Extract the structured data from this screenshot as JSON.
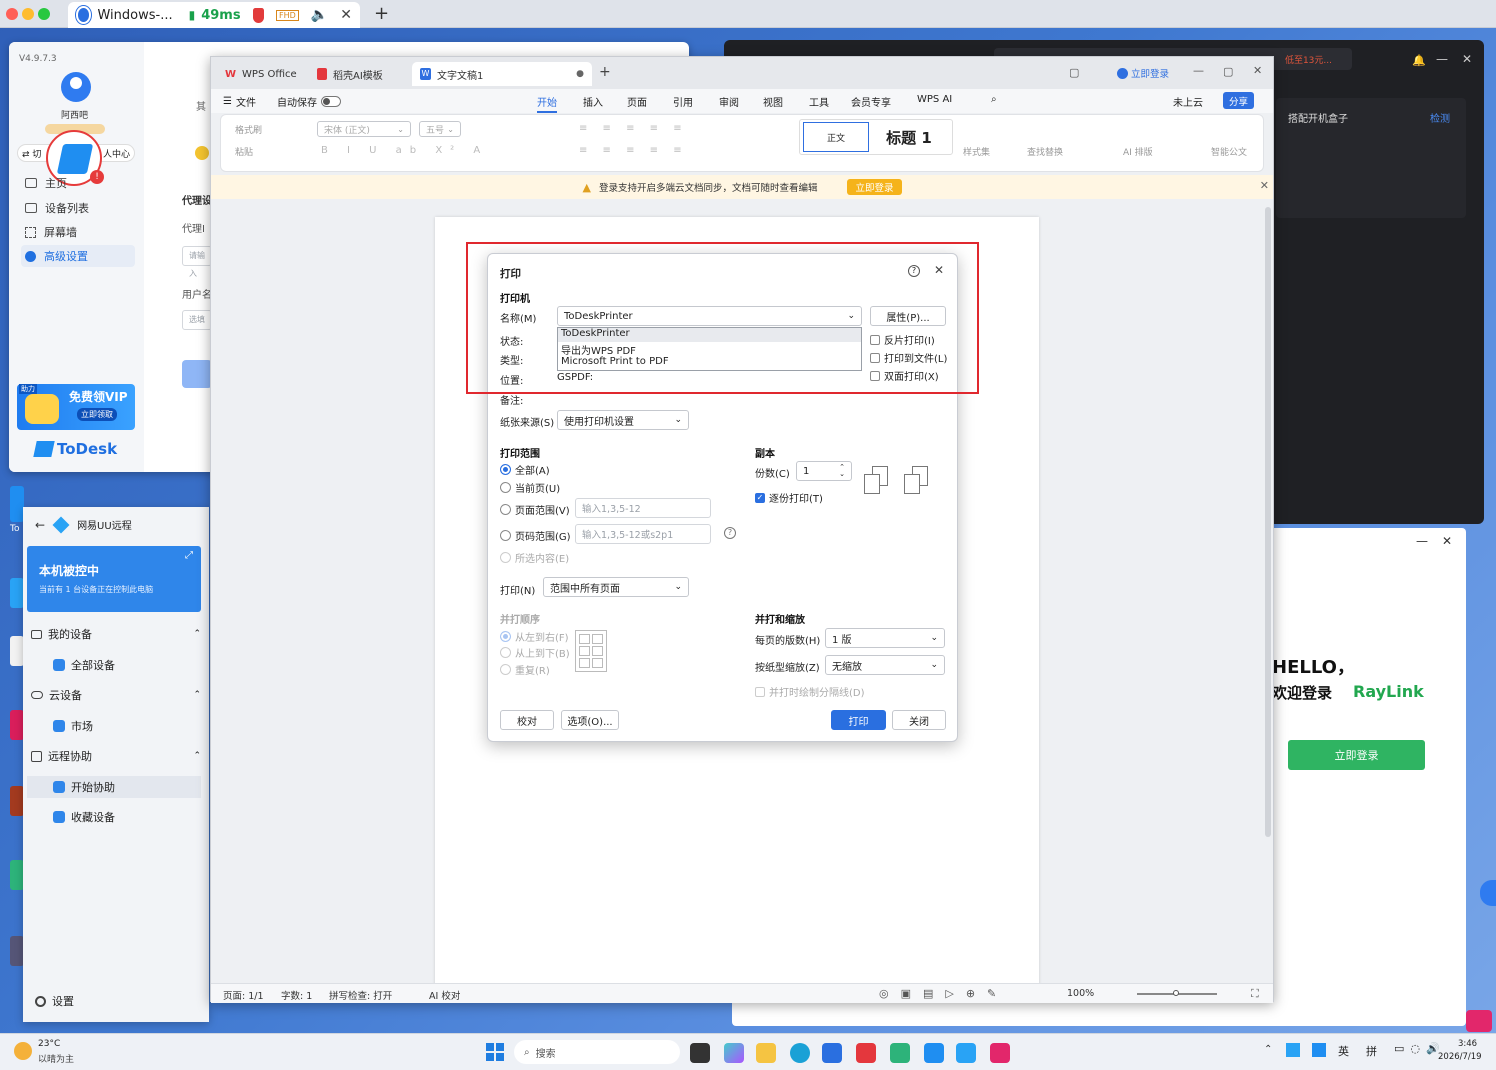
{
  "browser": {
    "tab_title": "Windows-...",
    "latency": "49ms",
    "fhd": "FHD",
    "new_tab": "+"
  },
  "todesk": {
    "version": "V4.9.7.3",
    "username": "阿西吧",
    "switch_label": "⇄ 切",
    "personal_center": "人中心",
    "nav": [
      "主页",
      "设备列表",
      "屏幕墙",
      "高级设置"
    ],
    "main_label_1": "其",
    "proxy_title": "代理设",
    "proxy_label": "代理I",
    "user_label": "用户名",
    "placeholder_1": "请输入",
    "placeholder_2": "选填",
    "vip_tag": "助力",
    "vip_text": "免费领VIP",
    "vip_btn": "立即领取",
    "brand": "ToDesk",
    "side_label": "To"
  },
  "uu": {
    "title": "网易UU远程",
    "status_title": "本机被控中",
    "status_sub": "当前有 1 台设备正在控制此电脑",
    "sections": [
      {
        "label": "我的设备",
        "children": [
          "全部设备"
        ]
      },
      {
        "label": "云设备",
        "children": [
          "市场"
        ]
      },
      {
        "label": "远程协助",
        "children": [
          "开始协助",
          "收藏设备"
        ]
      }
    ],
    "settings": "设置"
  },
  "dark_window": {
    "promo": "低至13元...",
    "item": "搭配开机盒子",
    "detect": "检测"
  },
  "raylink": {
    "hello": "HELLO，",
    "welcome": "欢迎登录",
    "brand": "RayLink",
    "login": "立即登录"
  },
  "wps": {
    "tabs": [
      "WPS Office",
      "稻壳AI模板",
      "文字文稿1"
    ],
    "login": "立即登录",
    "menu": [
      "文件",
      "自动保存",
      "开始",
      "插入",
      "页面",
      "引用",
      "审阅",
      "视图",
      "工具",
      "会员专享",
      "WPS AI"
    ],
    "cloud": "未上云",
    "share": "分享",
    "ribbon": {
      "format_painter": "格式刷",
      "paste": "粘贴",
      "font": "宋体 (正文)",
      "size": "五号",
      "style_normal": "正文",
      "style_h1": "标题 1",
      "style_set": "样式集",
      "find_replace": "查找替换",
      "ai_layout": "AI 排版",
      "smart_doc": "智能公文"
    },
    "notice": "登录支持开启多端云文档同步，文档可随时查看编辑",
    "notice_btn": "立即登录",
    "status": {
      "page": "页面: 1/1",
      "words": "字数: 1",
      "spell": "拼写检查: 打开",
      "ai_check": "AI 校对",
      "zoom": "100%"
    }
  },
  "print_dialog": {
    "title": "打印",
    "printer_section": "打印机",
    "name_label": "名称(M)",
    "name_value": "ToDeskPrinter",
    "properties": "属性(P)...",
    "printer_options": [
      "ToDeskPrinter",
      "导出为WPS PDF",
      "Microsoft Print to PDF"
    ],
    "status_label": "状态:",
    "type_label": "类型:",
    "location_label": "位置:",
    "location_value": "GSPDF:",
    "comment_label": "备注:",
    "reverse": "反片打印(I)",
    "to_file": "打印到文件(L)",
    "duplex": "双面打印(X)",
    "paper_source_label": "纸张来源(S)",
    "paper_source_value": "使用打印机设置",
    "range_section": "打印范围",
    "range_all": "全部(A)",
    "range_current": "当前页(U)",
    "range_pages": "页面范围(V)",
    "range_pages_ph": "输入1,3,5-12",
    "range_pagenum": "页码范围(G)",
    "range_pagenum_ph": "输入1,3,5-12或s2p1",
    "range_selection": "所选内容(E)",
    "copies_section": "副本",
    "copies_label": "份数(C)",
    "copies_value": "1",
    "collate": "逐份打印(T)",
    "print_label": "打印(N)",
    "print_value": "范围中所有页面",
    "order_section": "并打顺序",
    "order_ltr": "从左到右(F)",
    "order_ttb": "从上到下(B)",
    "order_repeat": "重复(R)",
    "zoom_section": "并打和缩放",
    "pages_per_sheet_label": "每页的版数(H)",
    "pages_per_sheet_value": "1 版",
    "scale_label": "按纸型缩放(Z)",
    "scale_value": "无缩放",
    "draw_lines": "并打时绘制分隔线(D)",
    "proof": "校对",
    "options": "选项(O)...",
    "print": "打印",
    "close": "关闭"
  },
  "taskbar": {
    "temp": "23°C",
    "weather": "以晴为主",
    "search": "搜索",
    "ime_1": "英",
    "ime_2": "拼",
    "time": "3:46",
    "date": "2026/7/19"
  }
}
